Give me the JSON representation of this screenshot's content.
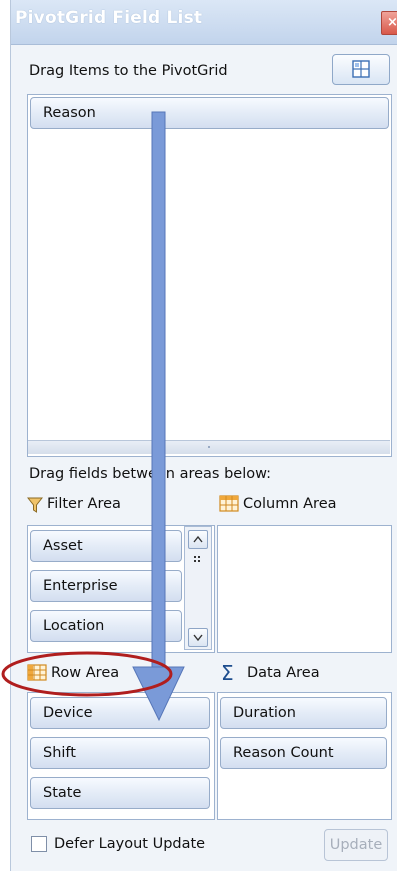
{
  "window": {
    "title": "PivotGrid Field List",
    "close_glyph": "×"
  },
  "header": {
    "instruction": "Drag Items to the PivotGrid",
    "layout_button_icon": "grid-layout-icon"
  },
  "field_list": {
    "items": [
      "Reason"
    ]
  },
  "areas_hint": "Drag fields between areas below:",
  "filter_area": {
    "label": "Filter Area",
    "icon": "funnel-icon",
    "items": [
      "Asset",
      "Enterprise",
      "Location"
    ]
  },
  "column_area": {
    "label": "Column Area",
    "icon": "table-icon",
    "items": []
  },
  "row_area": {
    "label": "Row Area",
    "icon": "table-icon",
    "items": [
      "Device",
      "Shift",
      "State"
    ]
  },
  "data_area": {
    "label": "Data Area",
    "icon": "sigma-icon",
    "items": [
      "Duration",
      "Reason Count"
    ]
  },
  "footer": {
    "defer_label": "Defer Layout Update",
    "defer_checked": false,
    "update_label": "Update"
  },
  "annotation": {
    "arrow_color": "#7a9ad8",
    "circle_color": "#b01e1e"
  }
}
